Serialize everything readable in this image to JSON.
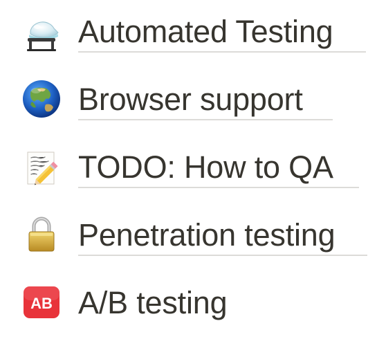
{
  "pages": [
    {
      "label": "Automated Testing",
      "icon": "flask-icon"
    },
    {
      "label": "Browser support",
      "icon": "globe-icon"
    },
    {
      "label": "TODO: How to QA",
      "icon": "memo-pencil-icon"
    },
    {
      "label": "Penetration testing",
      "icon": "lock-icon"
    },
    {
      "label": "A/B testing",
      "icon": "ab-button-icon",
      "icon_text": "AB"
    }
  ],
  "colors": {
    "text": "#37352f",
    "underline": "#dcdbd8",
    "ab_red": "#e8333a"
  }
}
